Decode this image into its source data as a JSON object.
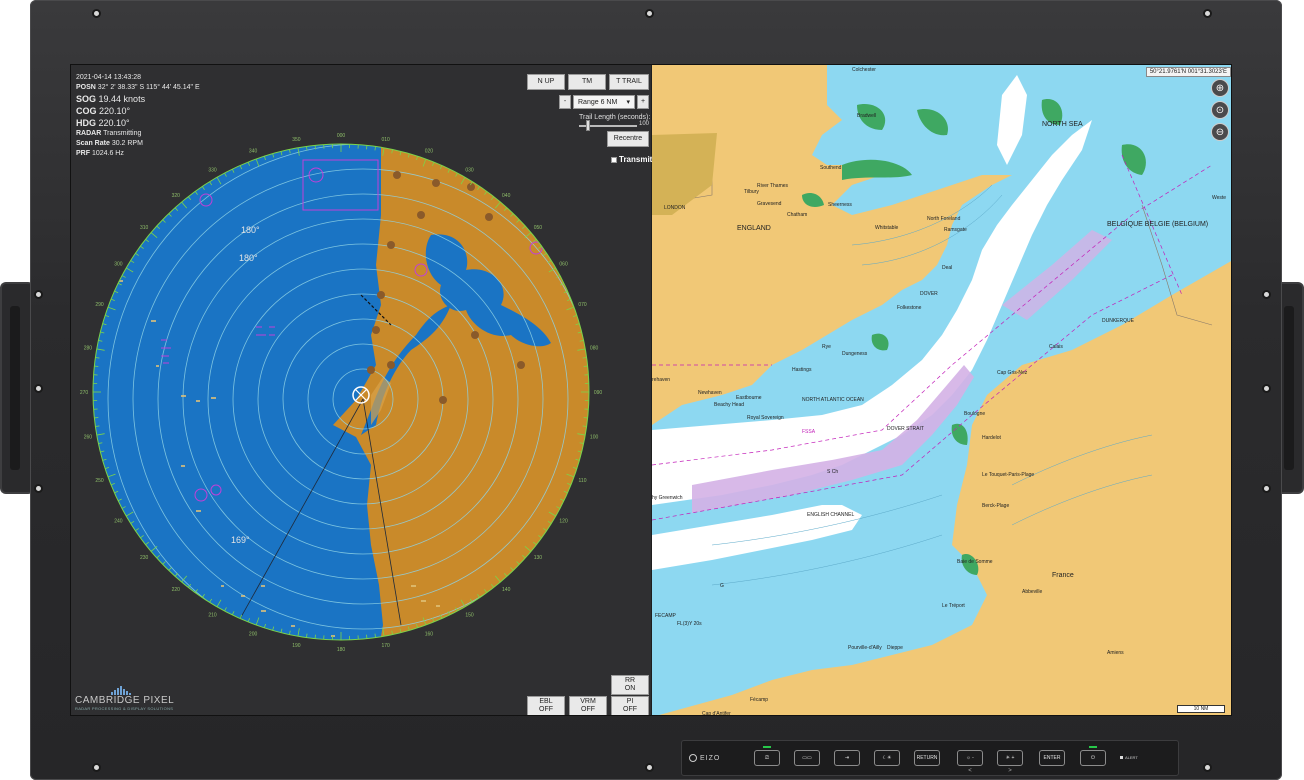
{
  "radar": {
    "readout": {
      "timestamp": "2021-04-14 13:43:28",
      "posn_label": "POSN",
      "posn_value": "32° 2' 38.33\" S  115° 44' 45.14\" E",
      "sog_label": "SOG",
      "sog_value": "19.44 knots",
      "cog_label": "COG",
      "cog_value": "220.10°",
      "hdg_label": "HDG",
      "hdg_value": "220.10°",
      "radar_label": "RADAR",
      "radar_value": "Transmitting",
      "scan_label": "Scan Rate",
      "scan_value": "30.2 RPM",
      "prf_label": "PRF",
      "prf_value": "1024.6 Hz"
    },
    "buttons": {
      "n_up": "N UP",
      "tm": "TM",
      "t_trail": "T TRAIL",
      "minus": "-",
      "plus": "+",
      "range": "Range 6 NM",
      "recentre": "Recentre",
      "rr_line1": "RR",
      "rr_line2": "ON",
      "ebl_line1": "EBL",
      "ebl_line2": "OFF",
      "vrm_line1": "VRM",
      "vrm_line2": "OFF",
      "pi_line1": "PI",
      "pi_line2": "OFF"
    },
    "trail_label": "Trail Length (seconds):",
    "trail_value": 100,
    "trail_fraction": 0.15,
    "trail_max_text": "100",
    "transmit_label": "Transmit",
    "bearing_labels": [
      "180°",
      "180°",
      "169°"
    ],
    "compass_labels": [
      "000",
      "010",
      "020",
      "030",
      "040",
      "050",
      "060",
      "070",
      "080",
      "090",
      "100",
      "110",
      "120",
      "130",
      "140",
      "150",
      "160",
      "170",
      "180",
      "190",
      "200",
      "210",
      "220",
      "230",
      "240",
      "250",
      "260",
      "270",
      "280",
      "290",
      "300",
      "310",
      "320",
      "330",
      "340",
      "350"
    ],
    "logo_name": "CAMBRIDGE PIXEL",
    "logo_tag": "RADAR PROCESSING & DISPLAY SOLUTIONS",
    "colors": {
      "sea": "#1a74c4",
      "land": "#c98a2a",
      "rings": "#8fd3e6",
      "ticks": "#7bd44a",
      "symbols": "#c040d8"
    }
  },
  "chart": {
    "coords": "50°21.9761'N  001°31.3023'E",
    "zoom_icons": [
      "zoom-in-icon",
      "zoom-search-icon",
      "zoom-out-icon"
    ],
    "scale": "10 NM",
    "labels": {
      "colchester": "Colchester",
      "bradwell": "Bradwell",
      "southend": "Southend",
      "river_thames": "River Thames",
      "tilbury": "Tilbury",
      "gravesend": "Gravesend",
      "london": "LONDON",
      "chatham": "Chatham",
      "sheerness": "Sheerness",
      "whitstable": "Whitstable",
      "north_foreland": "North Foreland",
      "ramsgate": "Ramsgate",
      "england": "ENGLAND",
      "deal": "Deal",
      "north_sea": "NORTH SEA",
      "belgique": "BELGIQUE BELGIE (BELGIUM)",
      "westende": "Weste",
      "dover": "DOVER",
      "folkestone": "Folkestone",
      "dunkerque": "DUNKERQUE",
      "calais": "Calais",
      "rye": "Rye",
      "dungeness": "Dungeness",
      "hastings": "Hastings",
      "cap_gris_nez": "Cap Gris-Nez",
      "newhaven": "Newhaven",
      "eastbourne": "Eastbourne",
      "beachy_head": "Beachy Head",
      "royal_sovereign": "Royal Sovereign",
      "north_atlantic": "NORTH ATLANTIC OCEAN",
      "boulogne": "Boulogne",
      "dover_strait": "DOVER STRAIT",
      "hardelot": "Hardelot",
      "fss": "FSSA",
      "s_ch": "S Ch",
      "le_touquet": "Le Touquet-Paris-Plage",
      "berck": "Berck-Plage",
      "greenwich": "hy Greenwich",
      "english_channel": "ENGLISH CHANNEL",
      "baie_somme": "Baie de Somme",
      "france": "France",
      "abbeville": "Abbeville",
      "fecamp_light": "FECAMP",
      "fl_light": "FL(3)Y 20s",
      "le_treport": "Le Tréport",
      "dieppe": "Dieppe",
      "pourville": "Pourville-d'Ailly",
      "amiens": "Amiens",
      "fecamp": "Fécamp",
      "cap_antifer": "Cap d'Antifer",
      "brighton": "rehaven",
      "g": "G"
    },
    "colors": {
      "land": "#f1c876",
      "shallow": "#8dd8f1",
      "deep": "#ffffff",
      "intertidal": "#3fa862",
      "tss": "#d4b1e6",
      "magenta": "#c21fb9"
    }
  },
  "controls": {
    "brand": "EIZO",
    "buttons": [
      "input-icon",
      "pip-icon",
      "signal-icon",
      "day-night-icon",
      "RETURN",
      "brightness-down-icon",
      "brightness-up-icon",
      "ENTER",
      "power-icon"
    ],
    "return_label": "RETURN",
    "enter_label": "ENTER",
    "minus_arrow": "<",
    "plus_arrow": ">",
    "alert_label": "ALERT"
  }
}
